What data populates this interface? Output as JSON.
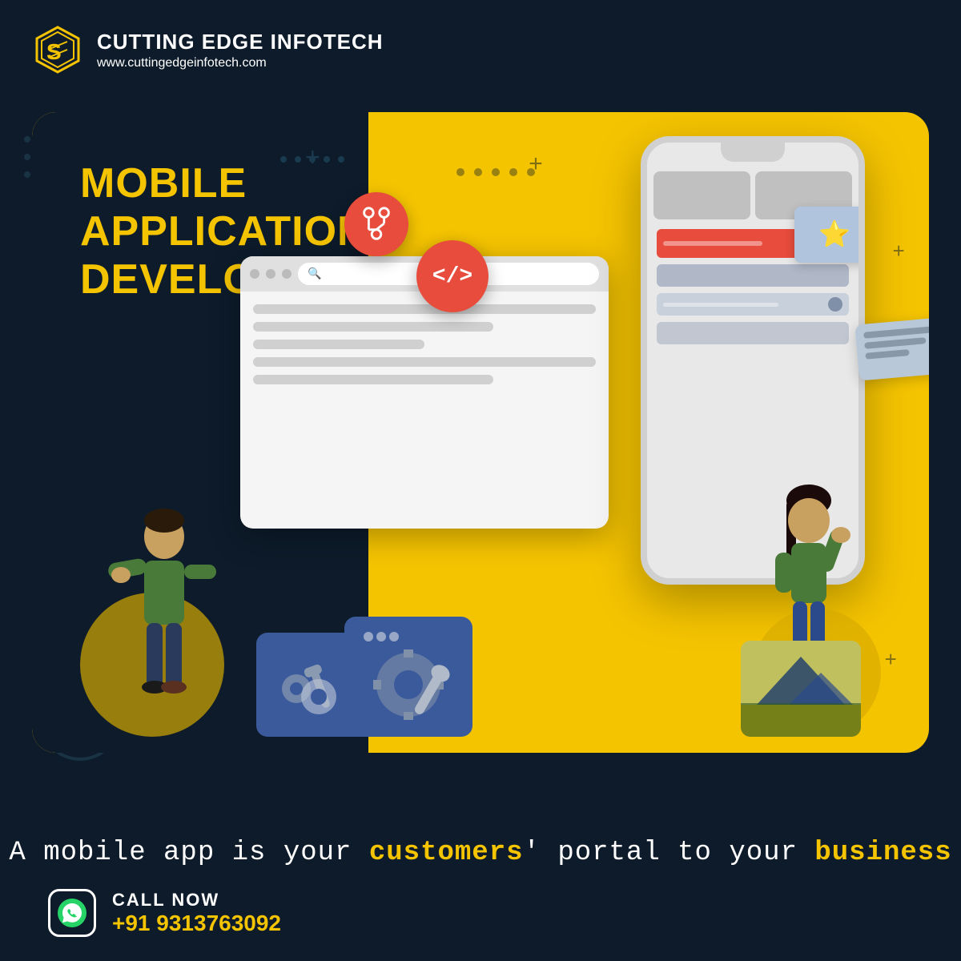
{
  "company": {
    "name": "CUTTING EDGE INFOTECH",
    "url": "www.cuttingedgeinfotech.com"
  },
  "hero": {
    "title_line1": "MOBILE APPLICATION",
    "title_line2": "DEVELOPMENT"
  },
  "tagline": {
    "text": "A mobile app is your customers' portal to your business",
    "highlight_words": [
      "customers",
      "business"
    ]
  },
  "cta": {
    "call_label": "CALL NOW",
    "phone": "+91 9313763092"
  },
  "colors": {
    "bg": "#0d1b2a",
    "yellow": "#f5c400",
    "white": "#ffffff",
    "red": "#e74c3c",
    "blue_dark": "#0d1b2a"
  },
  "icons": {
    "whatsapp": "whatsapp-icon",
    "logo": "company-logo-icon",
    "code": "</>"
  }
}
